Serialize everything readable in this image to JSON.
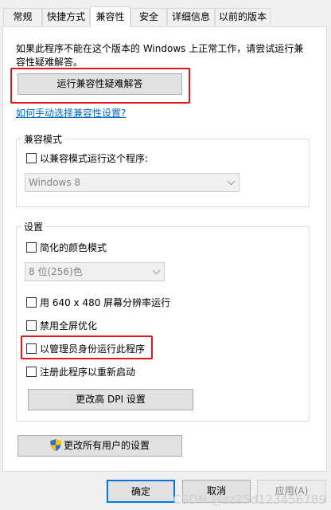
{
  "tabs": [
    {
      "label": "常规"
    },
    {
      "label": "快捷方式"
    },
    {
      "label": "兼容性"
    },
    {
      "label": "安全"
    },
    {
      "label": "详细信息"
    },
    {
      "label": "以前的版本"
    }
  ],
  "intro_line1": "如果此程序不能在这个版本的 Windows 上正常工作，请尝试运行兼",
  "intro_line2": "容性疑难解答。",
  "troubleshoot_button": "运行兼容性疑难解答",
  "manual_link": "如何手动选择兼容性设置?",
  "compat_mode": {
    "title": "兼容模式",
    "checkbox_label": "以兼容模式运行这个程序:",
    "checked": false,
    "select_value": "Windows 8"
  },
  "settings": {
    "title": "设置",
    "reduced_color_label": "简化的颜色模式",
    "color_select_value": "8 位(256)色",
    "res_640_label": "用 640 x 480 屏幕分辨率运行",
    "disable_fullscreen_label": "禁用全屏优化",
    "run_as_admin_label": "以管理员身份运行此程序",
    "register_restart_label": "注册此程序以重新启动",
    "dpi_button": "更改高 DPI 设置"
  },
  "all_users_button": "更改所有用户的设置",
  "footer": {
    "ok": "确定",
    "cancel": "取消",
    "apply": "应用(A)"
  },
  "watermark": "CSDN @sz25d123456789",
  "colors": {
    "highlight": "#e8141b",
    "link": "#0066cc"
  },
  "icons": {
    "uac": "shield-icon"
  }
}
